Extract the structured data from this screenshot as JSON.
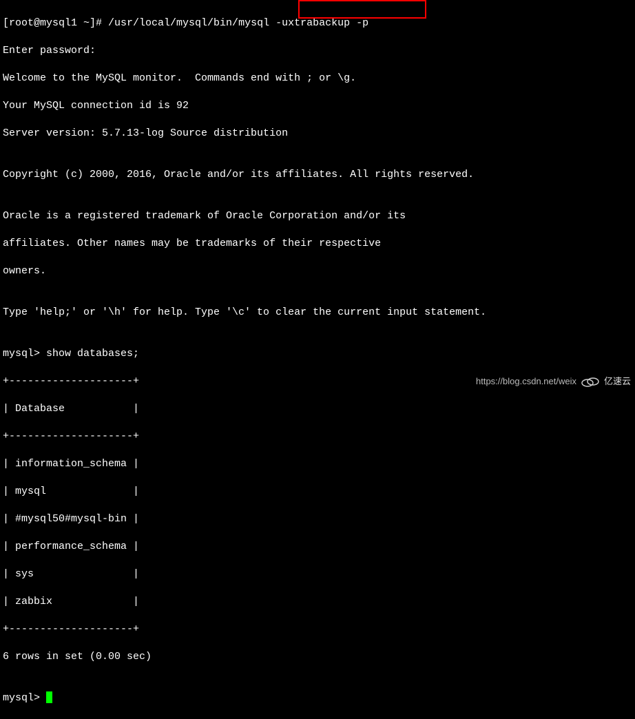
{
  "prompt": {
    "user_host": "[root@mysql1 ~]#",
    "command": " /usr/local/mysql/bin/mysql ",
    "highlighted_args": "-uxtrabackup -p"
  },
  "session": {
    "enter_password": "Enter password:",
    "welcome": "Welcome to the MySQL monitor.  Commands end with ; or \\g.",
    "conn_id": "Your MySQL connection id is 92",
    "server_version": "Server version: 5.7.13-log Source distribution",
    "blank1": "",
    "copyright": "Copyright (c) 2000, 2016, Oracle and/or its affiliates. All rights reserved.",
    "blank2": "",
    "trademark1": "Oracle is a registered trademark of Oracle Corporation and/or its",
    "trademark2": "affiliates. Other names may be trademarks of their respective",
    "trademark3": "owners.",
    "blank3": "",
    "help_line": "Type 'help;' or '\\h' for help. Type '\\c' to clear the current input statement.",
    "blank4": ""
  },
  "query": {
    "prompt": "mysql>",
    "cmd": " show databases;",
    "sep": "+--------------------+",
    "header": "| Database           |",
    "rows": [
      "| information_schema |",
      "| mysql              |",
      "| #mysql50#mysql-bin |",
      "| performance_schema |",
      "| sys                |",
      "| zabbix             |"
    ],
    "result": "6 rows in set (0.00 sec)",
    "blank": ""
  },
  "final_prompt": "mysql> ",
  "watermark": {
    "url": "https://blog.csdn.net/weix",
    "brand": "亿速云"
  }
}
